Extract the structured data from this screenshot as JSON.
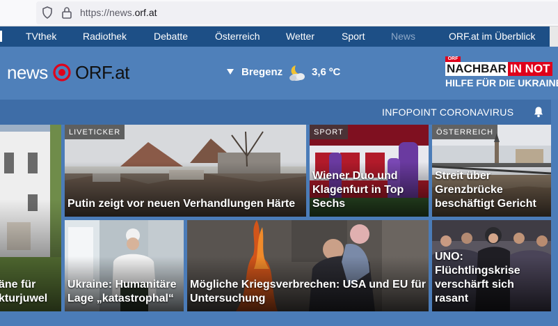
{
  "browser": {
    "url_prefix": "https://news.",
    "url_domain": "orf.at"
  },
  "nav": {
    "items": [
      "TVthek",
      "Radiothek",
      "Debatte",
      "Österreich",
      "Wetter",
      "Sport",
      "News",
      "ORF.at im Überblick"
    ],
    "active_item": "News"
  },
  "header": {
    "logo_news": "news",
    "logo_orf": "ORF.at",
    "weather_city": "Bregenz",
    "weather_temp": "3,6 ºC",
    "weather_icon": "partly-cloudy-night-icon",
    "campaign_tag": "ORF",
    "campaign_word1": "NACHBAR",
    "campaign_word2": "IN NOT",
    "campaign_line2": "HILFE FÜR DIE UKRAINE"
  },
  "infobar": {
    "link": "INFOPOINT CORONAVIRUS",
    "icon": "bell-icon"
  },
  "teasers": {
    "left": {
      "headline_line1": "äne für",
      "headline_line2": "kturjuwel"
    },
    "putin": {
      "tag": "LIVETICKER",
      "headline": "Putin zeigt vor neuen Verhandlungen Härte"
    },
    "sport": {
      "tag": "SPORT",
      "headline": "Wiener Duo und Klagenfurt in Top Sechs"
    },
    "oe": {
      "tag": "ÖSTERREICH",
      "headline": "Streit über Grenzbrücke beschäftigt Gericht"
    },
    "ukraine": {
      "headline": "Ukraine: Humanitäre Lage „katastrophal“"
    },
    "crimes": {
      "headline": "Mögliche Kriegsverbrechen: USA und EU für Untersuchung"
    },
    "uno": {
      "headline": "UNO: Flüchtlingskrise verschärft sich rasant"
    }
  },
  "colors": {
    "nav_bg": "#1d4f86",
    "header_bg": "#4f80ba",
    "infobar_bg": "#3e6da7",
    "brand_red": "#e0001a"
  }
}
